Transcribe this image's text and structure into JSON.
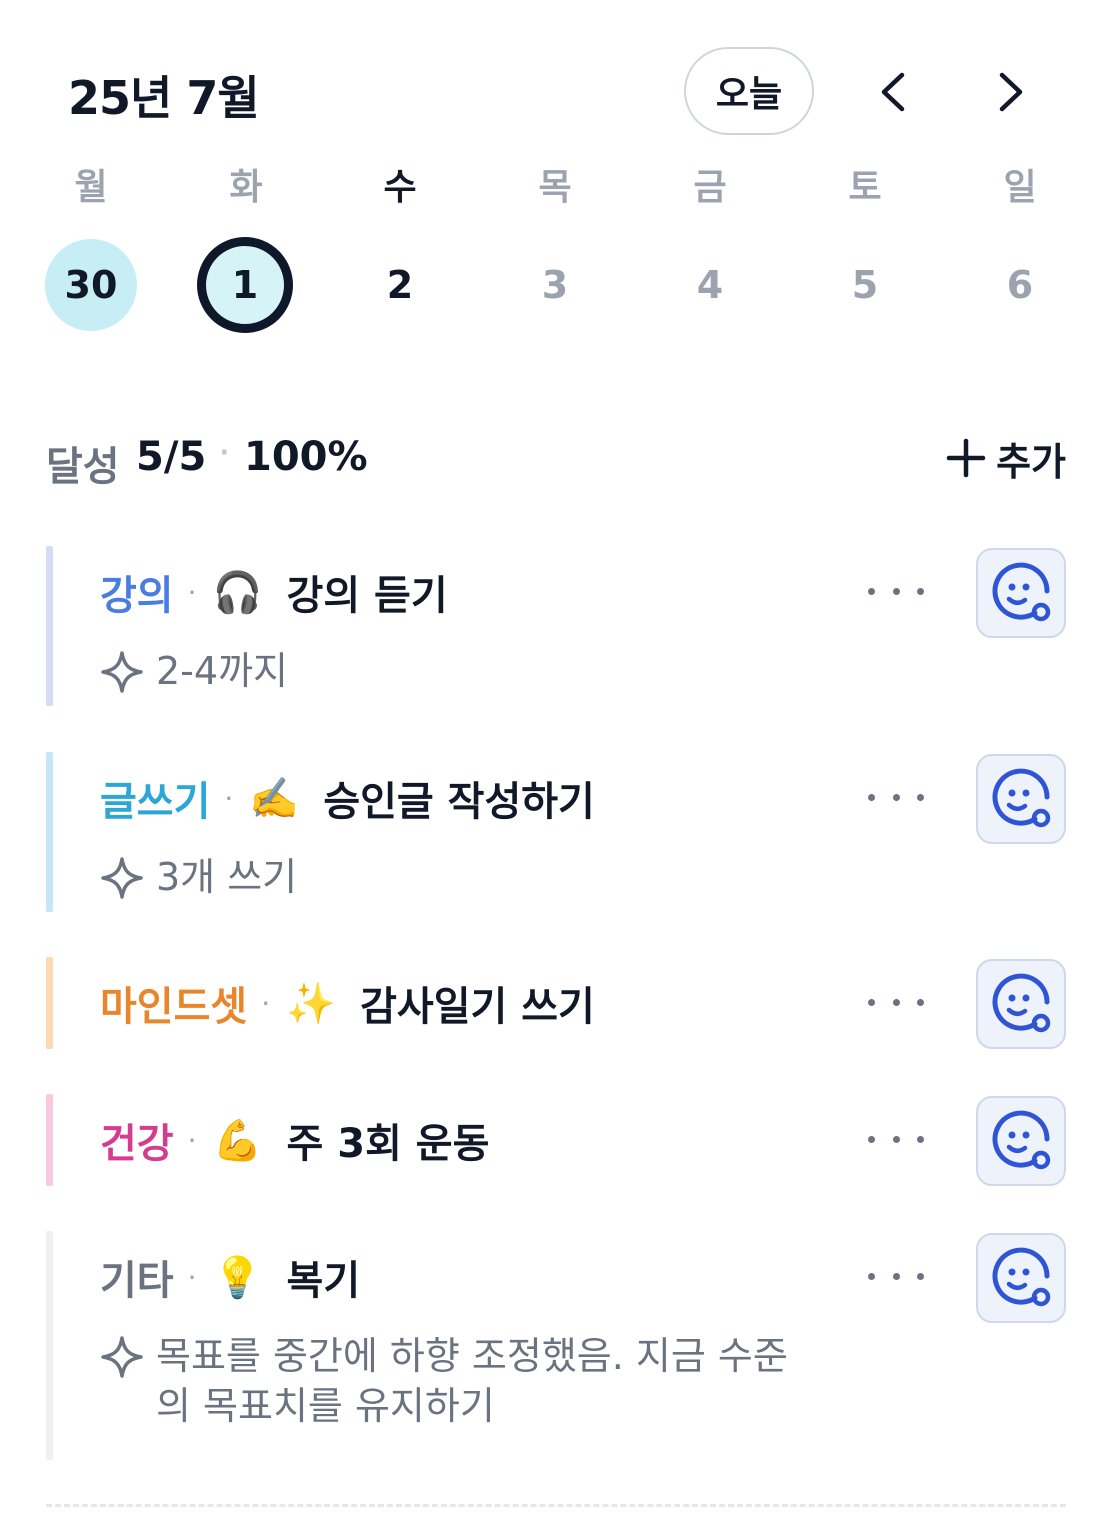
{
  "header": {
    "month_title": "25년 7월",
    "today_label": "오늘"
  },
  "weekdays": [
    "월",
    "화",
    "수",
    "목",
    "금",
    "토",
    "일"
  ],
  "dates": [
    "30",
    "1",
    "2",
    "3",
    "4",
    "5",
    "6"
  ],
  "summary": {
    "label": "달성",
    "count": "5/5",
    "separator": "·",
    "percent": "100%",
    "add_label": "추가"
  },
  "goals": [
    {
      "category": "강의",
      "category_color": "#4a7de0",
      "bar_color": "#d5dcf6",
      "separator": "·",
      "emoji": "🎧",
      "title": "강의 듣기",
      "note": "2-4까지"
    },
    {
      "category": "글쓰기",
      "category_color": "#2ba6d6",
      "bar_color": "#c4e6f6",
      "separator": "·",
      "emoji": "✍️",
      "title": "승인글 작성하기",
      "note": "3개 쓰기"
    },
    {
      "category": "마인드셋",
      "category_color": "#e8862c",
      "bar_color": "#fbdcb2",
      "separator": "·",
      "emoji": "✨",
      "title": "감사일기 쓰기"
    },
    {
      "category": "건강",
      "category_color": "#d63c8e",
      "bar_color": "#f9c9df",
      "separator": "·",
      "emoji": "💪",
      "title": "주 3회 운동"
    },
    {
      "category": "기타",
      "category_color": "#6b7280",
      "bar_color": "#eef0f3",
      "separator": "·",
      "emoji": "💡",
      "title": "복기",
      "note": "목표를 중간에 하향 조정했음. 지금 수준의 목표치를 유지하기"
    }
  ],
  "colors": {
    "accent": "#2f55d4",
    "selected_date_ring": "#0f172a",
    "first_date_bg": "#c7eef4"
  }
}
